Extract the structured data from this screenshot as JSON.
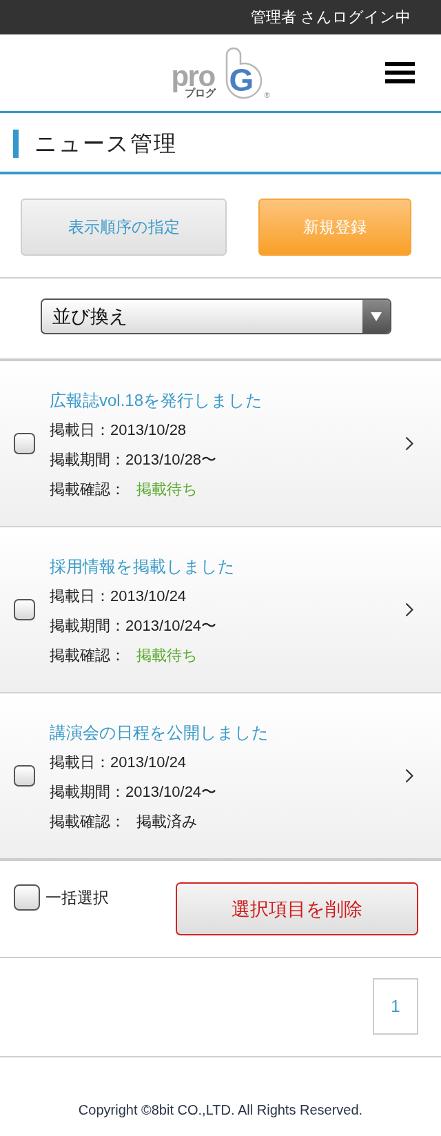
{
  "top_bar": {
    "login_status": "管理者 さんログイン中"
  },
  "header": {
    "logo": {
      "wordmark": "pro",
      "reading": "プログ",
      "letter": "G",
      "registered": "®"
    }
  },
  "page_title": "ニュース管理",
  "actions": [
    {
      "label": "表示順序の指定",
      "kind": "secondary"
    },
    {
      "label": "新規登録",
      "kind": "primary"
    }
  ],
  "sort_select": {
    "value": "並び換え"
  },
  "news_items": [
    {
      "title": "広報誌vol.18を発行しました",
      "published_date": "掲載日：2013/10/28",
      "period": "掲載期間：2013/10/28〜",
      "confirmation_label": "掲載確認：",
      "confirmation_status": "掲載待ち",
      "published": false,
      "checked": false
    },
    {
      "title": "採用情報を掲載しました",
      "published_date": "掲載日：2013/10/24",
      "period": "掲載期間：2013/10/24〜",
      "confirmation_label": "掲載確認：",
      "confirmation_status": "掲載待ち",
      "published": false,
      "checked": false
    },
    {
      "title": "講演会の日程を公開しました",
      "published_date": "掲載日：2013/10/24",
      "period": "掲載期間：2013/10/24〜",
      "confirmation_label": "掲載確認：",
      "confirmation_status": "掲載済み",
      "published": true,
      "checked": false
    }
  ],
  "bulk_bar": {
    "select_all": {
      "label": "一括選択",
      "checked": false
    },
    "delete_button": "選択項目を削除"
  },
  "pagination": [
    {
      "label": "1"
    }
  ],
  "footer": {
    "copyright": "Copyright ©8bit CO.,LTD. All Rights Reserved."
  }
}
